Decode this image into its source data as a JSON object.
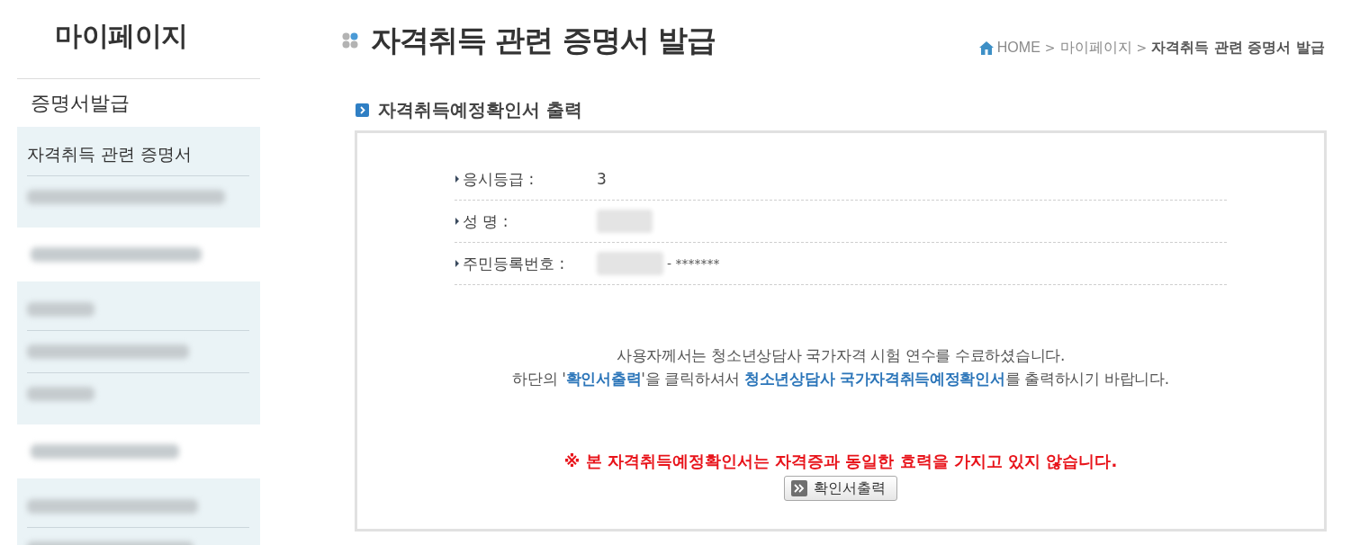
{
  "sidebar": {
    "title": "마이페이지",
    "items": [
      {
        "kind": "text",
        "label": "증명서발급",
        "children": [
          {
            "kind": "text",
            "label": "자격취득 관련 증명서"
          },
          {
            "kind": "blurred"
          }
        ]
      },
      {
        "kind": "blurred",
        "children": [
          {
            "kind": "blurred"
          },
          {
            "kind": "blurred"
          },
          {
            "kind": "blurred"
          }
        ]
      },
      {
        "kind": "blurred",
        "children": [
          {
            "kind": "blurred"
          },
          {
            "kind": "blurred"
          }
        ]
      }
    ]
  },
  "header": {
    "title": "자격취득 관련 증명서 발급",
    "breadcrumb": [
      {
        "kind": "home",
        "label": "HOME"
      },
      {
        "kind": "separator",
        "label": ">"
      },
      {
        "kind": "link",
        "label": "마이페이지"
      },
      {
        "kind": "separator",
        "label": ">"
      },
      {
        "kind": "current",
        "label": "자격취득 관련 증명서 발급"
      }
    ]
  },
  "section": {
    "title": "자격취득예정확인서 출력",
    "fields": [
      {
        "kind": "text",
        "label": "응시등급 :",
        "value": "3"
      },
      {
        "kind": "blurred",
        "label": "성 명 :"
      },
      {
        "kind": "blurred",
        "label": "주민등록번호 :",
        "suffix": "- *******"
      }
    ],
    "message": [
      "사용자께서는 청소년상담사 국가자격 시험 연수를 수료하셨습니다.",
      "하단의 '**확인서출력**'을 클릭하셔서 **청소년상담사 국가자격취득예정확인서**를 출력하시기 바랍니다."
    ],
    "notice": "※ 본 자격취득예정확인서는 자격증과 동일한 효력을 가지고 있지 않습니다.",
    "button": "확인서출력"
  }
}
